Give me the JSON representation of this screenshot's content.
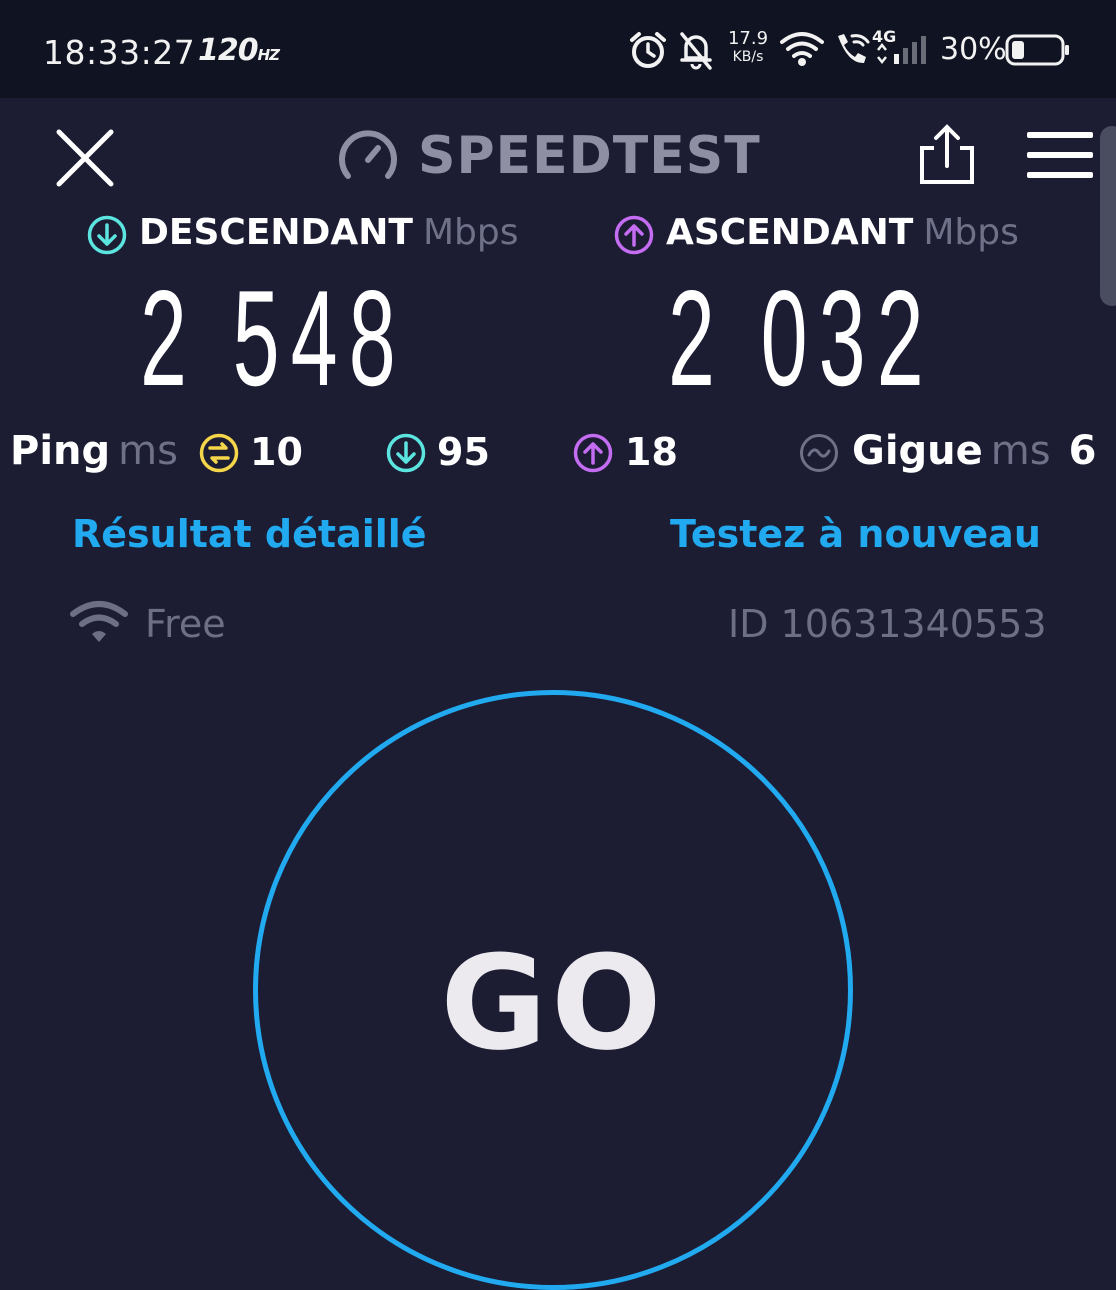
{
  "status_bar": {
    "time": "18:33:27",
    "refresh_rate": "120",
    "refresh_unit": "HZ",
    "net_speed_value": "17.9",
    "net_speed_unit": "KB/s",
    "network_type": "4G",
    "battery_percent": "30%",
    "icons": [
      "alarm-icon",
      "bell-off-icon",
      "wifi-icon",
      "wifi-calling-icon",
      "signal-icon",
      "battery-icon"
    ]
  },
  "header": {
    "close_icon": "close-icon",
    "logo_text": "SPEEDTEST",
    "share_icon": "share-icon",
    "menu_icon": "hamburger-menu-icon"
  },
  "download": {
    "label": "DESCENDANT",
    "unit": "Mbps",
    "value": "2 548",
    "color": "#5ce5e0"
  },
  "upload": {
    "label": "ASCENDANT",
    "unit": "Mbps",
    "value": "2 032",
    "color": "#c46cf2"
  },
  "ping": {
    "label": "Ping",
    "unit": "ms",
    "idle_value": "10",
    "download_value": "95",
    "upload_value": "18",
    "idle_color": "#f5d64b"
  },
  "jitter": {
    "label": "Gigue",
    "unit": "ms",
    "value": "6"
  },
  "links": {
    "detailed_result": "Résultat détaillé",
    "test_again": "Testez à nouveau",
    "color": "#21aaf0"
  },
  "connection": {
    "isp": "Free",
    "result_id": "ID 10631340553"
  },
  "go_button": {
    "label": "GO",
    "ring_color": "#21aaf0"
  }
}
